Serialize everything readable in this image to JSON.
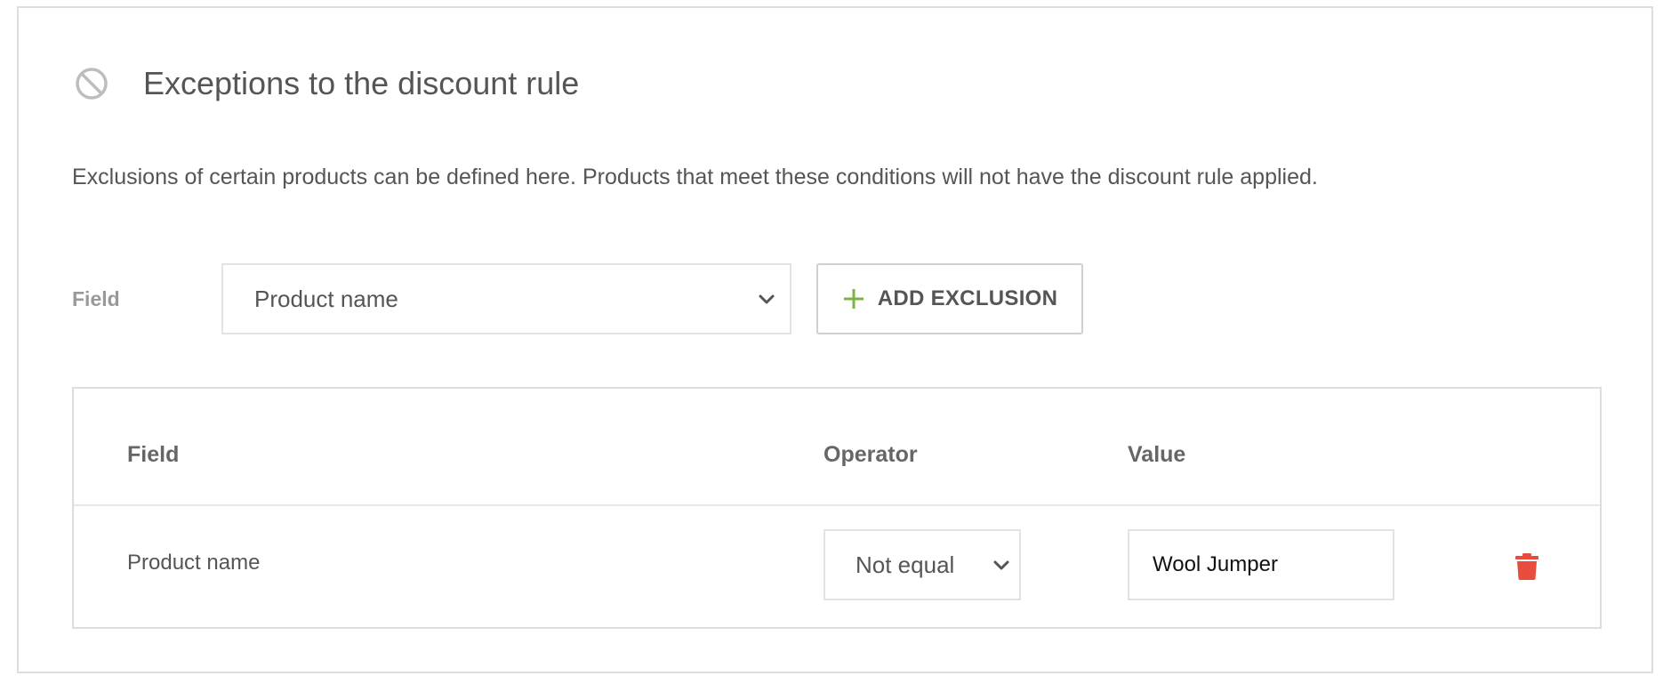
{
  "section": {
    "title": "Exceptions to the discount rule",
    "description": "Exclusions of certain products can be defined here. Products that meet these conditions will not have the discount rule applied."
  },
  "form": {
    "field_label": "Field",
    "field_select_value": "Product name",
    "add_button_label": "ADD EXCLUSION"
  },
  "table": {
    "headers": [
      "Field",
      "Operator",
      "Value"
    ],
    "rows": [
      {
        "field": "Product name",
        "operator": "Not equal",
        "value": "Wool Jumper"
      }
    ]
  },
  "icons": {
    "section_icon": "ban-icon",
    "select_chevron": "chevron-down-icon",
    "add_icon": "plus-icon",
    "delete_icon": "trash-icon"
  },
  "colors": {
    "accent_green": "#7cb342",
    "delete_red": "#e74c3c",
    "border": "#dddddd",
    "text": "#555555"
  }
}
